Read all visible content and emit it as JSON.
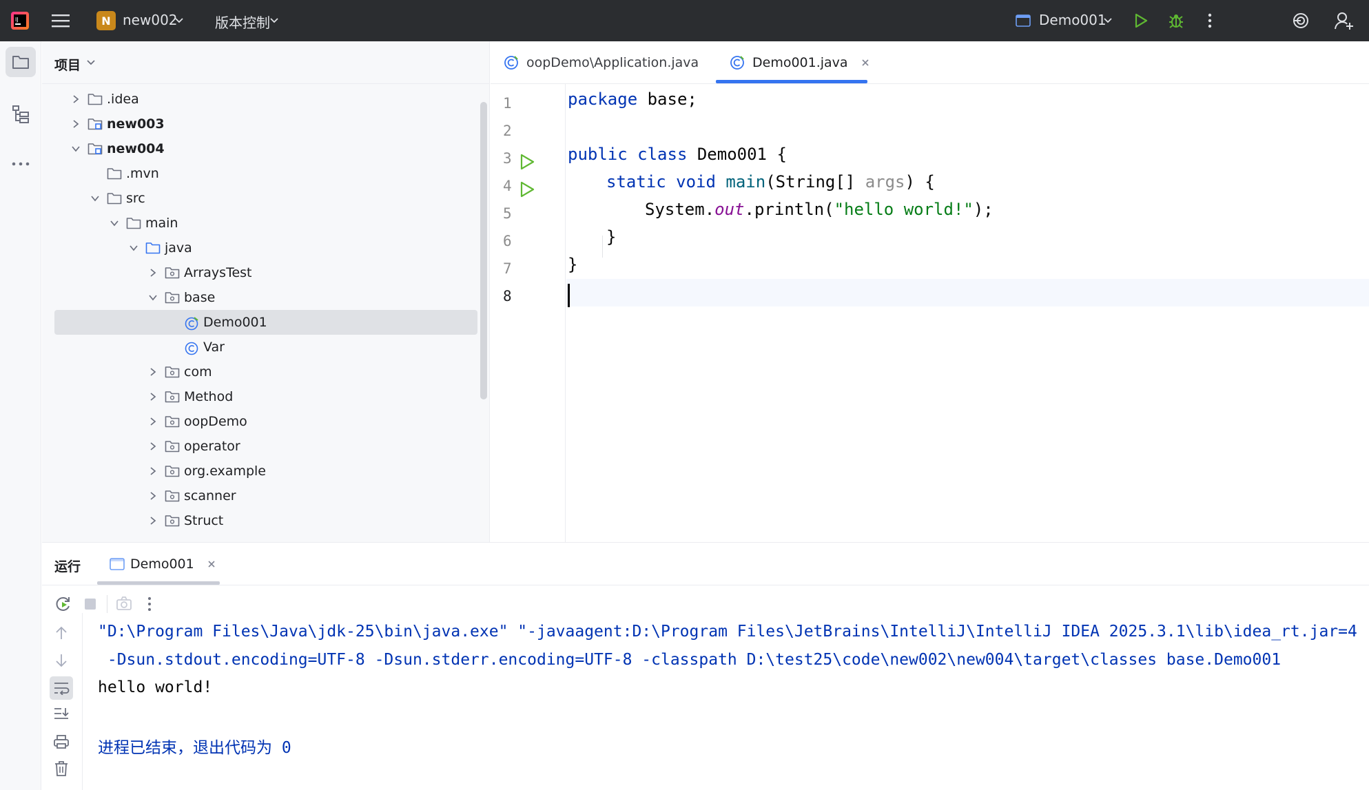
{
  "titlebar": {
    "project_badge": "N",
    "project_name": "new002",
    "vcs_label": "版本控制",
    "run_config": "Demo001"
  },
  "project_panel": {
    "title": "项目",
    "tree": [
      {
        "label": ".idea",
        "bold": false
      },
      {
        "label": "new003",
        "bold": true
      },
      {
        "label": "new004",
        "bold": true
      },
      {
        "label": ".mvn",
        "bold": false
      },
      {
        "label": "src",
        "bold": false
      },
      {
        "label": "main",
        "bold": false
      },
      {
        "label": "java",
        "bold": false
      },
      {
        "label": "ArraysTest",
        "bold": false
      },
      {
        "label": "base",
        "bold": false
      },
      {
        "label": "Demo001",
        "bold": false
      },
      {
        "label": "Var",
        "bold": false
      },
      {
        "label": "com",
        "bold": false
      },
      {
        "label": "Method",
        "bold": false
      },
      {
        "label": "oopDemo",
        "bold": false
      },
      {
        "label": "operator",
        "bold": false
      },
      {
        "label": "org.example",
        "bold": false
      },
      {
        "label": "scanner",
        "bold": false
      },
      {
        "label": "Struct",
        "bold": false
      }
    ]
  },
  "editor": {
    "tabs": [
      {
        "label": "oopDemo\\Application.java",
        "active": false
      },
      {
        "label": "Demo001.java",
        "active": true
      }
    ],
    "line_numbers": [
      "1",
      "2",
      "3",
      "4",
      "5",
      "6",
      "7",
      "8"
    ],
    "code": {
      "l1_kw": "package",
      "l1_rest": " base;",
      "l3_kw1": "public",
      "l3_kw2": "class",
      "l3_rest": " Demo001 {",
      "l4_kw1": "static",
      "l4_kw2": "void",
      "l4_fn": "main",
      "l4_mid": "(String[] ",
      "l4_par": "args",
      "l4_end": ") {",
      "l5_a": "System.",
      "l5_out": "out",
      "l5_b": ".println(",
      "l5_str": "\"hello world!\"",
      "l5_c": ");",
      "l6": "}",
      "l7": "}"
    }
  },
  "run_panel": {
    "title": "运行",
    "tab_label": "Demo001",
    "console": [
      "\"D:\\Program Files\\Java\\jdk-25\\bin\\java.exe\" \"-javaagent:D:\\Program Files\\JetBrains\\IntelliJ\\IntelliJ IDEA 2025.3.1\\lib\\idea_rt.jar=4",
      " -Dsun.stdout.encoding=UTF-8 -Dsun.stderr.encoding=UTF-8 -classpath D:\\test25\\code\\new002\\new004\\target\\classes base.Demo001",
      "hello world!",
      "",
      "进程已结束，退出代码为 0"
    ]
  },
  "colors": {
    "titlebar_bg": "#2b2d30",
    "accent": "#3574f0",
    "run_green": "#5fb832",
    "keyword": "#0033b3",
    "string": "#067d17",
    "console_cmd": "#0033b3"
  }
}
